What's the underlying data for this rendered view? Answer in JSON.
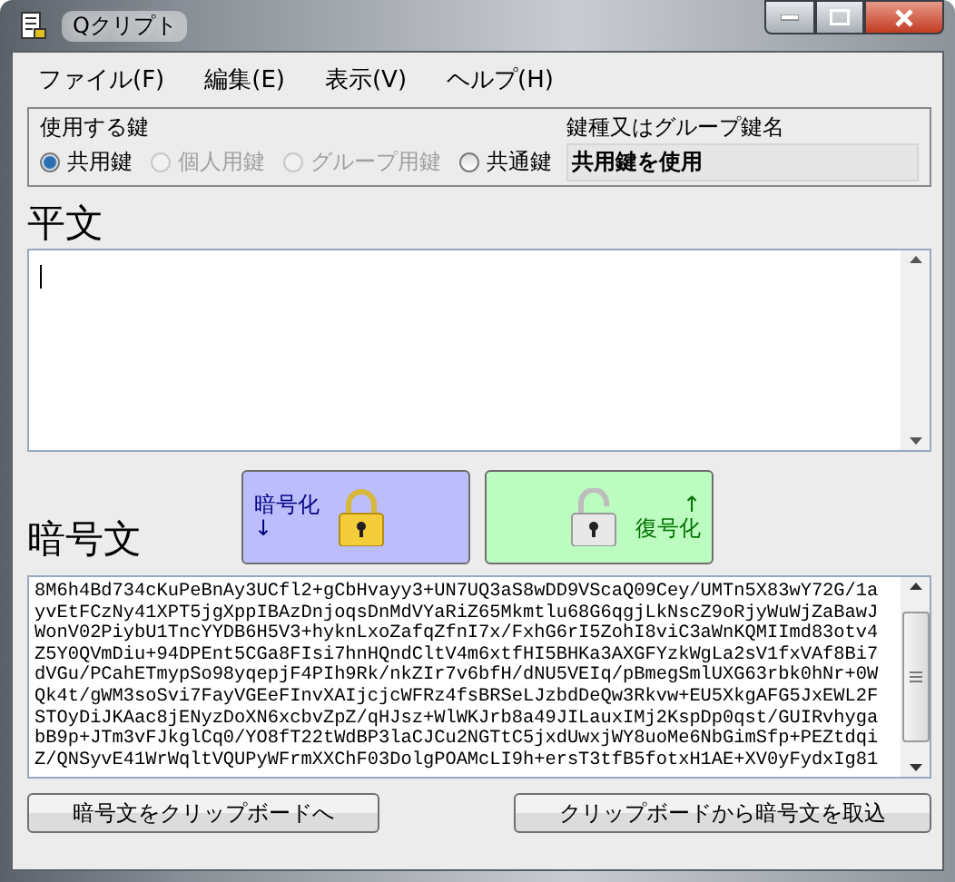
{
  "window": {
    "title": "Qクリプト"
  },
  "menu": [
    "ファイル(F)",
    "編集(E)",
    "表示(V)",
    "ヘルプ(H)"
  ],
  "key_group": {
    "title": "使用する鍵",
    "options": [
      {
        "label": "共用鍵",
        "selected": true,
        "disabled": false
      },
      {
        "label": "個人用鍵",
        "selected": false,
        "disabled": true
      },
      {
        "label": "グループ用鍵",
        "selected": false,
        "disabled": true
      },
      {
        "label": "共通鍵",
        "selected": false,
        "disabled": false
      }
    ],
    "name_label": "鍵種又はグループ鍵名",
    "name_value": "共用鍵を使用"
  },
  "plain": {
    "label": "平文"
  },
  "encrypt_button": {
    "label": "暗号化",
    "arrow": "↓"
  },
  "decrypt_button": {
    "label": "復号化",
    "arrow": "↑"
  },
  "cipher": {
    "label": "暗号文",
    "lines": [
      "8M6h4Bd734cKuPeBnAy3UCfl2+gCbHvayy3+UN7UQ3aS8wDD9VScaQ09Cey/UMTn5X83wY72G/1a",
      "yvEtFCzNy41XPT5jgXppIBAzDnjoqsDnMdVYaRiZ65Mkmtlu68G6qgjLkNscZ9oRjyWuWjZaBawJ",
      "WonV02PiybU1TncYYDB6H5V3+hyknLxoZafqZfnI7x/FxhG6rI5ZohI8viC3aWnKQMIImd83otv4",
      "Z5Y0QVmDiu+94DPEnt5CGa8FIsi7hnHQndCltV4m6xtfHI5BHKa3AXGFYzkWgLa2sV1fxVAf8Bi7",
      "dVGu/PCahETmypSo98yqepjF4PIh9Rk/nkZIr7v6bfH/dNU5VEIq/pBmegSmlUXG63rbk0hNr+0W",
      "Qk4t/gWM3soSvi7FayVGEeFInvXAIjcjcWFRz4fsBRSeLJzbdDeQw3Rkvw+EU5XkgAFG5JxEWL2F",
      "STOyDiJKAac8jENyzDoXN6xcbvZpZ/qHJsz+WlWKJrb8a49JILauxIMj2KspDp0qst/GUIRvhyga",
      "bB9p+JTm3vFJkglCq0/YO8fT22tWdBP3laCJCu2NGTtC5jxdUwxjWY8uoMe6NbGimSfp+PEZtdqi",
      "Z/QNSyvE41WrWqltVQUPyWFrmXXChF03DolgPOAMcLI9h+ersT3tfB5fotxH1AE+XV0yFydxIg81"
    ]
  },
  "bottom_buttons": [
    "暗号文をクリップボードへ",
    "クリップボードから暗号文を取込"
  ]
}
